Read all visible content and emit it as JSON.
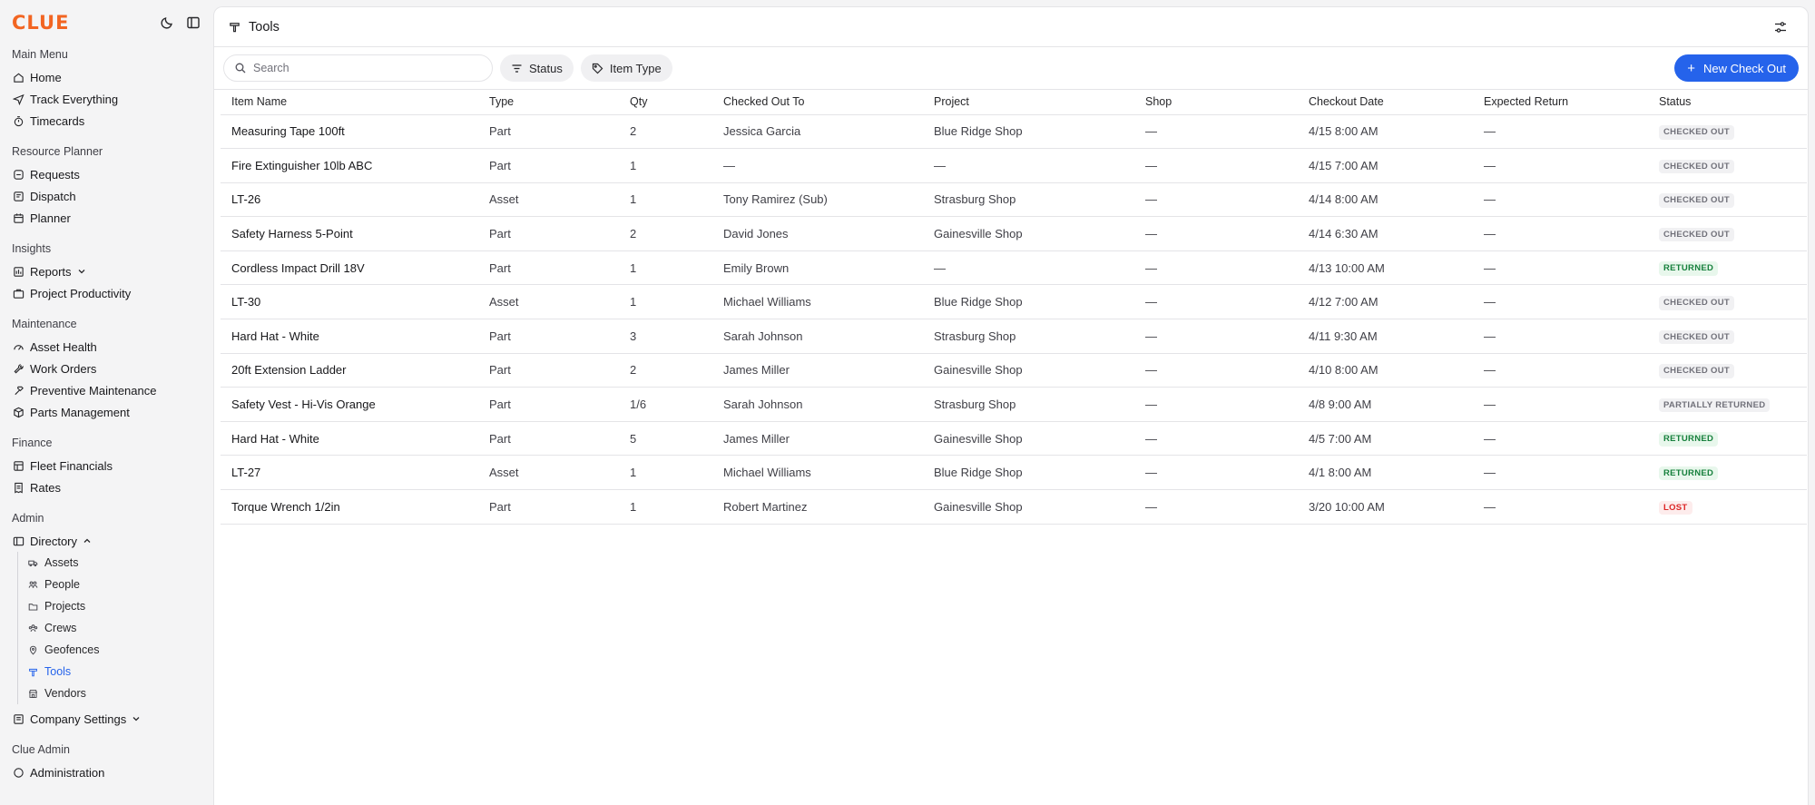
{
  "brand": {
    "logo": "CLUE"
  },
  "sidebar": {
    "sections": [
      {
        "label": "Main Menu",
        "items": [
          {
            "label": "Home",
            "icon": "home-icon"
          },
          {
            "label": "Track Everything",
            "icon": "send-icon"
          },
          {
            "label": "Timecards",
            "icon": "timer-icon"
          }
        ]
      },
      {
        "label": "Resource Planner",
        "items": [
          {
            "label": "Requests",
            "icon": "requests-icon"
          },
          {
            "label": "Dispatch",
            "icon": "dispatch-icon"
          },
          {
            "label": "Planner",
            "icon": "calendar-icon"
          }
        ]
      },
      {
        "label": "Insights",
        "items": [
          {
            "label": "Reports",
            "icon": "reports-icon",
            "chevron": "down"
          },
          {
            "label": "Project Productivity",
            "icon": "briefcase-icon"
          }
        ]
      },
      {
        "label": "Maintenance",
        "items": [
          {
            "label": "Asset Health",
            "icon": "gauge-icon"
          },
          {
            "label": "Work Orders",
            "icon": "wrench-icon"
          },
          {
            "label": "Preventive Maintenance",
            "icon": "hammer-icon"
          },
          {
            "label": "Parts Management",
            "icon": "package-icon"
          }
        ]
      },
      {
        "label": "Finance",
        "items": [
          {
            "label": "Fleet Financials",
            "icon": "ledger-icon"
          },
          {
            "label": "Rates",
            "icon": "receipt-icon"
          }
        ]
      }
    ],
    "admin": {
      "label": "Admin",
      "directory": {
        "label": "Directory",
        "icon": "directory-icon"
      },
      "directory_items": [
        {
          "label": "Assets",
          "icon": "truck-icon"
        },
        {
          "label": "People",
          "icon": "people-icon"
        },
        {
          "label": "Projects",
          "icon": "folder-icon"
        },
        {
          "label": "Crews",
          "icon": "crews-icon"
        },
        {
          "label": "Geofences",
          "icon": "pin-icon"
        },
        {
          "label": "Tools",
          "icon": "tools-icon",
          "active": true
        },
        {
          "label": "Vendors",
          "icon": "store-icon"
        }
      ],
      "company_settings": {
        "label": "Company Settings",
        "icon": "settings-building-icon"
      }
    },
    "clue_admin": {
      "label": "Clue Admin",
      "administration": {
        "label": "Administration",
        "icon": "circle-icon"
      }
    }
  },
  "header": {
    "title": "Tools"
  },
  "toolbar": {
    "search_placeholder": "Search",
    "status_filter": "Status",
    "item_type_filter": "Item Type",
    "new_button": "New Check Out"
  },
  "table": {
    "columns": [
      "Item Name",
      "Type",
      "Qty",
      "Checked Out To",
      "Project",
      "Shop",
      "Checkout Date",
      "Expected Return",
      "Status"
    ],
    "rows": [
      {
        "name": "Measuring Tape 100ft",
        "type": "Part",
        "qty": "2",
        "to": "Jessica Garcia",
        "project": "Blue Ridge Shop",
        "shop": "—",
        "date": "4/15 8:00 AM",
        "ret": "—",
        "status": "CHECKED OUT",
        "kind": "checked"
      },
      {
        "name": "Fire Extinguisher 10lb ABC",
        "type": "Part",
        "qty": "1",
        "to": "—",
        "project": "—",
        "shop": "—",
        "date": "4/15 7:00 AM",
        "ret": "—",
        "status": "CHECKED OUT",
        "kind": "checked"
      },
      {
        "name": "LT-26",
        "type": "Asset",
        "qty": "1",
        "to": "Tony Ramirez (Sub)",
        "project": "Strasburg Shop",
        "shop": "—",
        "date": "4/14 8:00 AM",
        "ret": "—",
        "status": "CHECKED OUT",
        "kind": "checked"
      },
      {
        "name": "Safety Harness 5-Point",
        "type": "Part",
        "qty": "2",
        "to": "David Jones",
        "project": "Gainesville Shop",
        "shop": "—",
        "date": "4/14 6:30 AM",
        "ret": "—",
        "status": "CHECKED OUT",
        "kind": "checked"
      },
      {
        "name": "Cordless Impact Drill 18V",
        "type": "Part",
        "qty": "1",
        "to": "Emily Brown",
        "project": "—",
        "shop": "—",
        "date": "4/13 10:00 AM",
        "ret": "—",
        "status": "RETURNED",
        "kind": "returned"
      },
      {
        "name": "LT-30",
        "type": "Asset",
        "qty": "1",
        "to": "Michael Williams",
        "project": "Blue Ridge Shop",
        "shop": "—",
        "date": "4/12 7:00 AM",
        "ret": "—",
        "status": "CHECKED OUT",
        "kind": "checked"
      },
      {
        "name": "Hard Hat - White",
        "type": "Part",
        "qty": "3",
        "to": "Sarah Johnson",
        "project": "Strasburg Shop",
        "shop": "—",
        "date": "4/11 9:30 AM",
        "ret": "—",
        "status": "CHECKED OUT",
        "kind": "checked"
      },
      {
        "name": "20ft Extension Ladder",
        "type": "Part",
        "qty": "2",
        "to": "James Miller",
        "project": "Gainesville Shop",
        "shop": "—",
        "date": "4/10 8:00 AM",
        "ret": "—",
        "status": "CHECKED OUT",
        "kind": "checked"
      },
      {
        "name": "Safety Vest - Hi-Vis Orange",
        "type": "Part",
        "qty": "1/6",
        "to": "Sarah Johnson",
        "project": "Strasburg Shop",
        "shop": "—",
        "date": "4/8 9:00 AM",
        "ret": "—",
        "status": "PARTIALLY RETURNED",
        "kind": "partial"
      },
      {
        "name": "Hard Hat - White",
        "type": "Part",
        "qty": "5",
        "to": "James Miller",
        "project": "Gainesville Shop",
        "shop": "—",
        "date": "4/5 7:00 AM",
        "ret": "—",
        "status": "RETURNED",
        "kind": "returned"
      },
      {
        "name": "LT-27",
        "type": "Asset",
        "qty": "1",
        "to": "Michael Williams",
        "project": "Blue Ridge Shop",
        "shop": "—",
        "date": "4/1 8:00 AM",
        "ret": "—",
        "status": "RETURNED",
        "kind": "returned"
      },
      {
        "name": "Torque Wrench 1/2in",
        "type": "Part",
        "qty": "1",
        "to": "Robert Martinez",
        "project": "Gainesville Shop",
        "shop": "—",
        "date": "3/20 10:00 AM",
        "ret": "—",
        "status": "LOST",
        "kind": "lost"
      }
    ]
  },
  "colors": {
    "brand": "#f26522",
    "accent": "#2563eb",
    "returned": "#16803c",
    "lost": "#dc2626"
  }
}
